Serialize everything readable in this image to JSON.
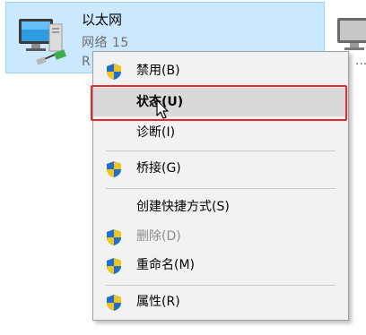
{
  "adapter": {
    "name": "以太网",
    "network": "网络  15",
    "device_prefix": "R",
    "icon": "network-adapter-icon",
    "selected_bg": "#cce8ff"
  },
  "adapter_2": {
    "icon": "network-adapter-icon",
    "ellipsis": "..."
  },
  "context_menu": {
    "items": [
      {
        "label": "禁用(B)",
        "shield": true,
        "disabled": false,
        "bold": false
      },
      {
        "label": "状态(U)",
        "shield": false,
        "disabled": false,
        "bold": true,
        "hovered": true
      },
      {
        "label": "诊断(I)",
        "shield": false,
        "disabled": false,
        "bold": false
      },
      {
        "label": "桥接(G)",
        "shield": true,
        "disabled": false,
        "bold": false
      },
      {
        "label": "创建快捷方式(S)",
        "shield": false,
        "disabled": false,
        "bold": false
      },
      {
        "label": "删除(D)",
        "shield": true,
        "disabled": true,
        "bold": false
      },
      {
        "label": "重命名(M)",
        "shield": true,
        "disabled": false,
        "bold": false
      },
      {
        "label": "属性(R)",
        "shield": true,
        "disabled": false,
        "bold": false
      }
    ]
  },
  "highlight_color": "#e42a2a"
}
